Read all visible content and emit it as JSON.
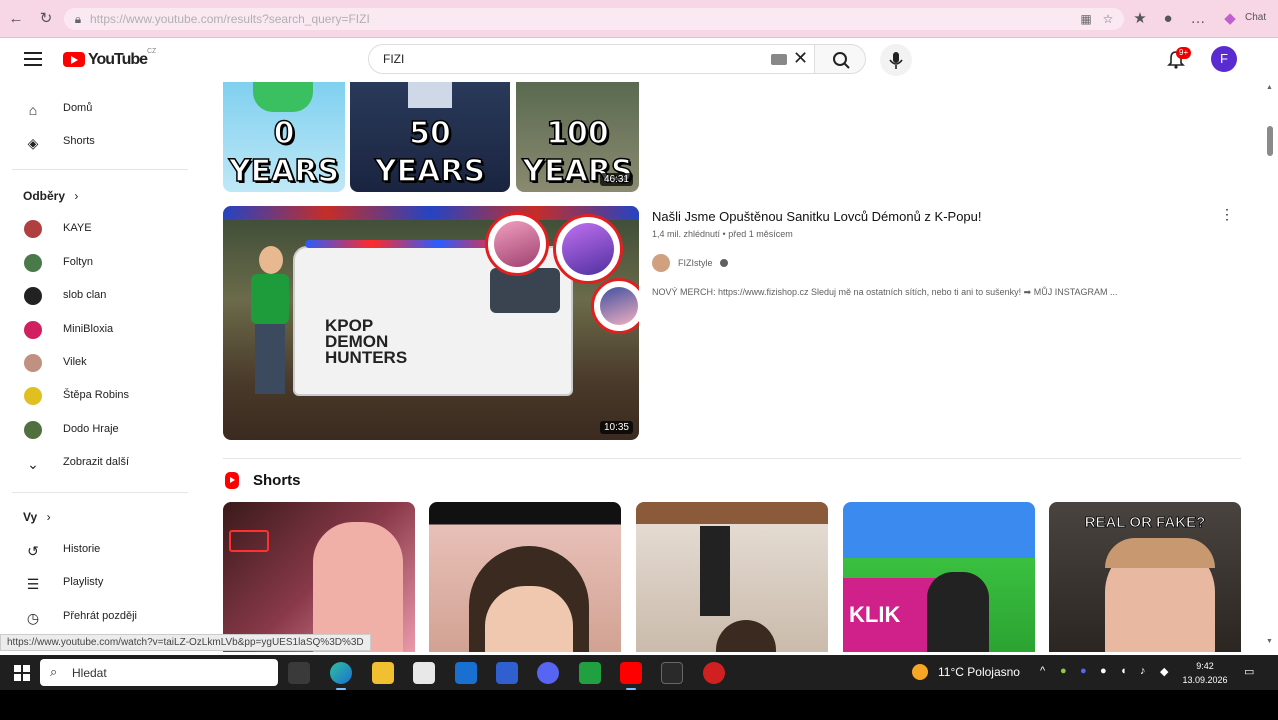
{
  "browser": {
    "url": "https://www.youtube.com/results?search_query=FIZI",
    "copilot_label": "Chat"
  },
  "header": {
    "logo_text": "YouTube",
    "logo_country": "CZ",
    "search_value": "FIZI",
    "notification_count": "9+",
    "avatar_letter": "F"
  },
  "sidebar": {
    "home": "Domů",
    "shorts": "Shorts",
    "subscriptions_heading": "Odběry",
    "subscriptions": [
      "KAYE",
      "Foltyn",
      "slob clan",
      "MiniBloxia",
      "Vilek",
      "Štěpa Robins",
      "Dodo Hraje"
    ],
    "subscription_colors": [
      "#b04040",
      "#4a7a4a",
      "#222222",
      "#d02060",
      "#c09080",
      "#e0c020",
      "#507040"
    ],
    "show_more": "Zobrazit další",
    "you_heading": "Vy",
    "history": "Historie",
    "playlists": "Playlisty",
    "watch_later": "Přehrát později"
  },
  "top_thumbs": [
    {
      "line1": "0",
      "line2": "YEARS"
    },
    {
      "line1": "50",
      "line2": "YEARS"
    },
    {
      "line1": "100",
      "line2": "YEARS"
    }
  ],
  "top_duration": "46:31",
  "video": {
    "title": "Našli Jsme Opuštěnou Sanitku Lovců Démonů z K-Popu!",
    "meta": "1,4 mil. zhlédnutí • před 1 měsícem",
    "channel": "FIZIstyle",
    "description": "NOVÝ MERCH: https://www.fizishop.cz Sleduj mě na ostatních sítích, nebo ti ani to sušenky! ➡ MŮJ INSTAGRAM ...",
    "duration": "10:35",
    "thumb_text": "KPOP DEMON HUNTERS"
  },
  "shorts": {
    "heading": "Shorts",
    "short4_text": "KLIK",
    "short5_text": "REAL OR FAKE?"
  },
  "status_url": "https://www.youtube.com/watch?v=taiLZ-OzLkmLVb&pp=ygUES1laSQ%3D%3D",
  "taskbar": {
    "search_placeholder": "Hledat",
    "weather_temp": "11°C",
    "weather_desc": "Polojasno",
    "time": "9:42",
    "date": "13.09.2026"
  }
}
